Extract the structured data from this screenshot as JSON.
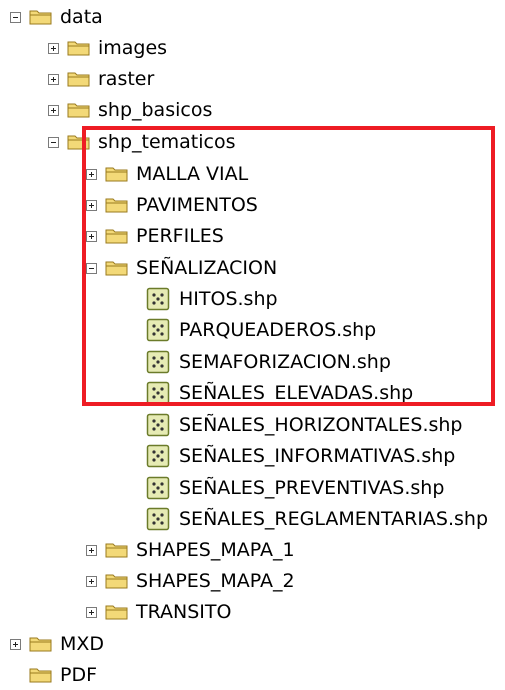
{
  "colors": {
    "folder_fill": "#f3d978",
    "folder_stroke": "#9a7a1e",
    "shapefile_fill": "#e6ebb4",
    "shapefile_stroke": "#6b7b2a",
    "highlight": "#ee1c24"
  },
  "tree": [
    {
      "label": "data",
      "icon": "folder-icon",
      "toggle": "minus"
    },
    {
      "label": "images",
      "icon": "folder-icon",
      "toggle": "plus"
    },
    {
      "label": "raster",
      "icon": "folder-icon",
      "toggle": "plus"
    },
    {
      "label": "shp_basicos",
      "icon": "folder-icon",
      "toggle": "plus"
    },
    {
      "label": "shp_tematicos",
      "icon": "folder-icon",
      "toggle": "minus"
    },
    {
      "label": "MALLA VIAL",
      "icon": "folder-icon",
      "toggle": "plus"
    },
    {
      "label": "PAVIMENTOS",
      "icon": "folder-icon",
      "toggle": "plus"
    },
    {
      "label": "PERFILES",
      "icon": "folder-icon",
      "toggle": "plus"
    },
    {
      "label": "SEÑALIZACION",
      "icon": "folder-icon",
      "toggle": "minus"
    },
    {
      "label": "HITOS.shp",
      "icon": "shapefile-point-icon",
      "toggle": "none"
    },
    {
      "label": "PARQUEADEROS.shp",
      "icon": "shapefile-point-icon",
      "toggle": "none"
    },
    {
      "label": "SEMAFORIZACION.shp",
      "icon": "shapefile-point-icon",
      "toggle": "none"
    },
    {
      "label": "SEÑALES_ELEVADAS.shp",
      "icon": "shapefile-point-icon",
      "toggle": "none"
    },
    {
      "label": "SEÑALES_HORIZONTALES.shp",
      "icon": "shapefile-point-icon",
      "toggle": "none"
    },
    {
      "label": "SEÑALES_INFORMATIVAS.shp",
      "icon": "shapefile-point-icon",
      "toggle": "none"
    },
    {
      "label": "SEÑALES_PREVENTIVAS.shp",
      "icon": "shapefile-point-icon",
      "toggle": "none"
    },
    {
      "label": "SEÑALES_REGLAMENTARIAS.shp",
      "icon": "shapefile-point-icon",
      "toggle": "none"
    },
    {
      "label": "SHAPES_MAPA_1",
      "icon": "folder-icon",
      "toggle": "plus"
    },
    {
      "label": "SHAPES_MAPA_2",
      "icon": "folder-icon",
      "toggle": "plus"
    },
    {
      "label": "TRANSITO",
      "icon": "folder-icon",
      "toggle": "plus"
    },
    {
      "label": "MXD",
      "icon": "folder-icon",
      "toggle": "plus"
    },
    {
      "label": "PDF",
      "icon": "folder-icon",
      "toggle": "none"
    }
  ]
}
